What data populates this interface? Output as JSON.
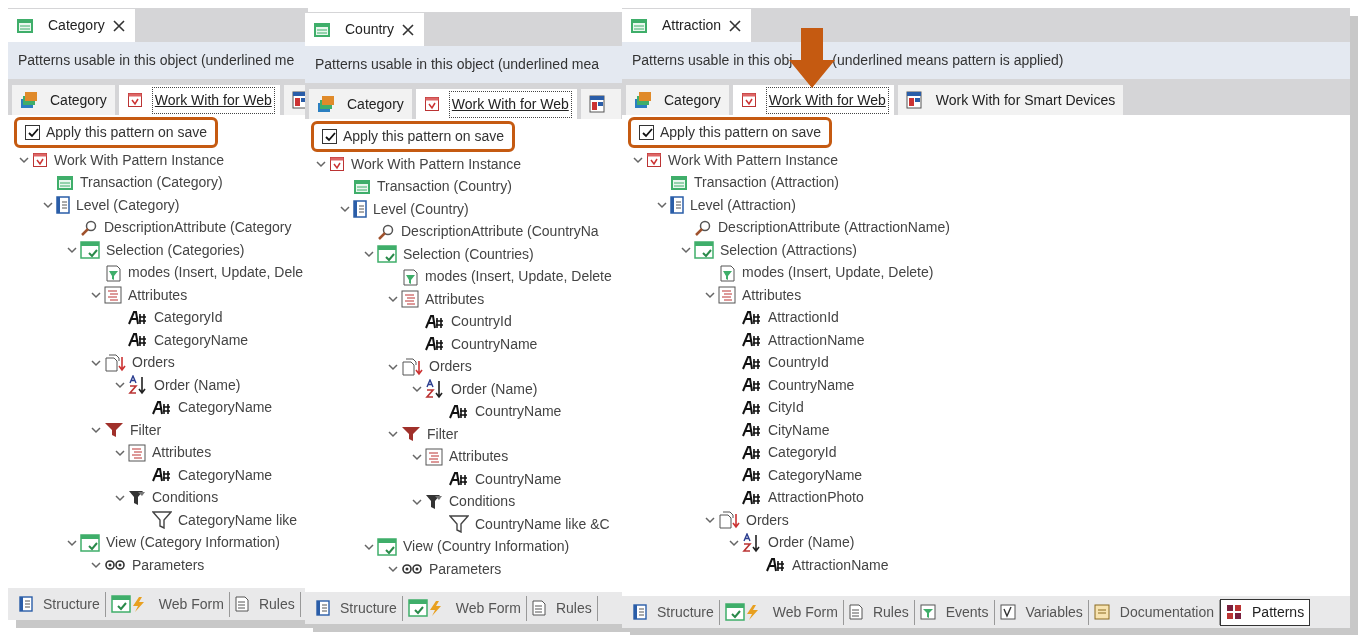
{
  "windows": [
    {
      "tab_title": "Category",
      "header": [
        "Patterns usable in this object (underlined me"
      ],
      "pattern_tabs": [
        {
          "label": "Category",
          "kind": "category",
          "selected": false,
          "applied": false
        },
        {
          "label": "Work With for Web",
          "kind": "workwith",
          "selected": true,
          "applied": true,
          "pointed": false
        },
        {
          "kind": "smart",
          "selected": false
        }
      ],
      "apply_on_save": {
        "label": "Apply this pattern on save",
        "checked": true,
        "highlighted": true
      },
      "tree": [
        {
          "label": "Work With Pattern Instance",
          "kind": "pattern",
          "expanded": true,
          "children": [
            {
              "label": "Transaction (Category)",
              "kind": "transaction"
            },
            {
              "label": "Level (Category)",
              "kind": "level",
              "expanded": true,
              "children": [
                {
                  "label": "DescriptionAttribute (Category",
                  "kind": "description"
                },
                {
                  "label": "Selection (Categories)",
                  "kind": "selection",
                  "expanded": true,
                  "children": [
                    {
                      "label": "modes (Insert, Update, Dele",
                      "kind": "modes"
                    },
                    {
                      "label": "Attributes",
                      "kind": "attributes",
                      "expanded": true,
                      "children": [
                        {
                          "label": "CategoryId",
                          "kind": "attribute"
                        },
                        {
                          "label": "CategoryName",
                          "kind": "attribute"
                        }
                      ]
                    },
                    {
                      "label": "Orders",
                      "kind": "orders",
                      "expanded": true,
                      "children": [
                        {
                          "label": "Order (Name)",
                          "kind": "order",
                          "expanded": true,
                          "children": [
                            {
                              "label": "CategoryName",
                              "kind": "attribute"
                            }
                          ]
                        }
                      ]
                    },
                    {
                      "label": "Filter",
                      "kind": "filter",
                      "expanded": true,
                      "children": [
                        {
                          "label": "Attributes",
                          "kind": "attributes",
                          "expanded": true,
                          "children": [
                            {
                              "label": "CategoryName",
                              "kind": "attribute"
                            }
                          ]
                        },
                        {
                          "label": "Conditions",
                          "kind": "conditions",
                          "expanded": true,
                          "children": [
                            {
                              "label": "CategoryName like",
                              "kind": "condition"
                            }
                          ]
                        }
                      ]
                    }
                  ]
                },
                {
                  "label": "View (Category Information)",
                  "kind": "view",
                  "expanded": true,
                  "children": [
                    {
                      "label": "Parameters",
                      "kind": "parameters",
                      "expanded": true
                    }
                  ]
                }
              ]
            }
          ]
        }
      ],
      "bottom_tabs": [
        {
          "label": "Structure",
          "kind": "structure",
          "selected": false
        },
        {
          "label": "Web Form",
          "kind": "webform",
          "selected": false
        },
        {
          "label": "Rules",
          "kind": "rules",
          "selected": false
        }
      ]
    },
    {
      "tab_title": "Country",
      "header": [
        "Patterns usable in this object (underlined mea"
      ],
      "pattern_tabs": [
        {
          "label": "Category",
          "kind": "category",
          "selected": false,
          "applied": false
        },
        {
          "label": "Work With for Web",
          "kind": "workwith",
          "selected": true,
          "applied": true,
          "pointed": false
        },
        {
          "kind": "smart",
          "selected": false
        }
      ],
      "apply_on_save": {
        "label": "Apply this pattern on save",
        "checked": true,
        "highlighted": true
      },
      "tree": [
        {
          "label": "Work With Pattern Instance",
          "kind": "pattern",
          "expanded": true,
          "children": [
            {
              "label": "Transaction (Country)",
              "kind": "transaction"
            },
            {
              "label": "Level (Country)",
              "kind": "level",
              "expanded": true,
              "children": [
                {
                  "label": "DescriptionAttribute (CountryNa",
                  "kind": "description"
                },
                {
                  "label": "Selection (Countries)",
                  "kind": "selection",
                  "expanded": true,
                  "children": [
                    {
                      "label": "modes (Insert, Update, Delete",
                      "kind": "modes"
                    },
                    {
                      "label": "Attributes",
                      "kind": "attributes",
                      "expanded": true,
                      "children": [
                        {
                          "label": "CountryId",
                          "kind": "attribute"
                        },
                        {
                          "label": "CountryName",
                          "kind": "attribute"
                        }
                      ]
                    },
                    {
                      "label": "Orders",
                      "kind": "orders",
                      "expanded": true,
                      "children": [
                        {
                          "label": "Order (Name)",
                          "kind": "order",
                          "expanded": true,
                          "children": [
                            {
                              "label": "CountryName",
                              "kind": "attribute"
                            }
                          ]
                        }
                      ]
                    },
                    {
                      "label": "Filter",
                      "kind": "filter",
                      "expanded": true,
                      "children": [
                        {
                          "label": "Attributes",
                          "kind": "attributes",
                          "expanded": true,
                          "children": [
                            {
                              "label": "CountryName",
                              "kind": "attribute"
                            }
                          ]
                        },
                        {
                          "label": "Conditions",
                          "kind": "conditions",
                          "expanded": true,
                          "children": [
                            {
                              "label": "CountryName like &C",
                              "kind": "condition"
                            }
                          ]
                        }
                      ]
                    }
                  ]
                },
                {
                  "label": "View (Country Information)",
                  "kind": "view",
                  "expanded": true,
                  "children": [
                    {
                      "label": "Parameters",
                      "kind": "parameters",
                      "expanded": true
                    }
                  ]
                }
              ]
            }
          ]
        }
      ],
      "bottom_tabs": [
        {
          "label": "Structure",
          "kind": "structure",
          "selected": false
        },
        {
          "label": "Web Form",
          "kind": "webform",
          "selected": false
        },
        {
          "label": "Rules",
          "kind": "rules",
          "selected": false
        }
      ]
    },
    {
      "tab_title": "Attraction",
      "header": [
        "Patterns usable in this obj",
        "(underlined means pattern is applied)"
      ],
      "pattern_tabs": [
        {
          "label": "Category",
          "kind": "category",
          "selected": false,
          "applied": false
        },
        {
          "label": "Work With for Web",
          "kind": "workwith",
          "selected": true,
          "applied": true,
          "pointed": true
        },
        {
          "label": "Work With for Smart Devices",
          "kind": "smart",
          "selected": false,
          "applied": false
        }
      ],
      "apply_on_save": {
        "label": "Apply this pattern on save",
        "checked": true,
        "highlighted": true
      },
      "tree": [
        {
          "label": "Work With Pattern Instance",
          "kind": "pattern",
          "expanded": true,
          "children": [
            {
              "label": "Transaction (Attraction)",
              "kind": "transaction"
            },
            {
              "label": "Level (Attraction)",
              "kind": "level",
              "expanded": true,
              "children": [
                {
                  "label": "DescriptionAttribute (AttractionName)",
                  "kind": "description"
                },
                {
                  "label": "Selection (Attractions)",
                  "kind": "selection",
                  "expanded": true,
                  "children": [
                    {
                      "label": "modes (Insert, Update, Delete)",
                      "kind": "modes"
                    },
                    {
                      "label": "Attributes",
                      "kind": "attributes",
                      "expanded": true,
                      "children": [
                        {
                          "label": "AttractionId",
                          "kind": "attribute"
                        },
                        {
                          "label": "AttractionName",
                          "kind": "attribute"
                        },
                        {
                          "label": "CountryId",
                          "kind": "attribute"
                        },
                        {
                          "label": "CountryName",
                          "kind": "attribute"
                        },
                        {
                          "label": "CityId",
                          "kind": "attribute"
                        },
                        {
                          "label": "CityName",
                          "kind": "attribute"
                        },
                        {
                          "label": "CategoryId",
                          "kind": "attribute"
                        },
                        {
                          "label": "CategoryName",
                          "kind": "attribute"
                        },
                        {
                          "label": "AttractionPhoto",
                          "kind": "attribute"
                        }
                      ]
                    },
                    {
                      "label": "Orders",
                      "kind": "orders",
                      "expanded": true,
                      "children": [
                        {
                          "label": "Order (Name)",
                          "kind": "order",
                          "expanded": true,
                          "children": [
                            {
                              "label": "AttractionName",
                              "kind": "attribute"
                            }
                          ]
                        }
                      ]
                    }
                  ]
                }
              ]
            }
          ]
        }
      ],
      "bottom_tabs": [
        {
          "label": "Structure",
          "kind": "structure",
          "selected": false
        },
        {
          "label": "Web Form",
          "kind": "webform",
          "selected": false
        },
        {
          "label": "Rules",
          "kind": "rules",
          "selected": false
        },
        {
          "label": "Events",
          "kind": "events",
          "selected": false
        },
        {
          "label": "Variables",
          "kind": "variables",
          "selected": false
        },
        {
          "label": "Documentation",
          "kind": "documentation",
          "selected": false
        },
        {
          "label": "Patterns",
          "kind": "patterns",
          "selected": true
        }
      ]
    }
  ]
}
